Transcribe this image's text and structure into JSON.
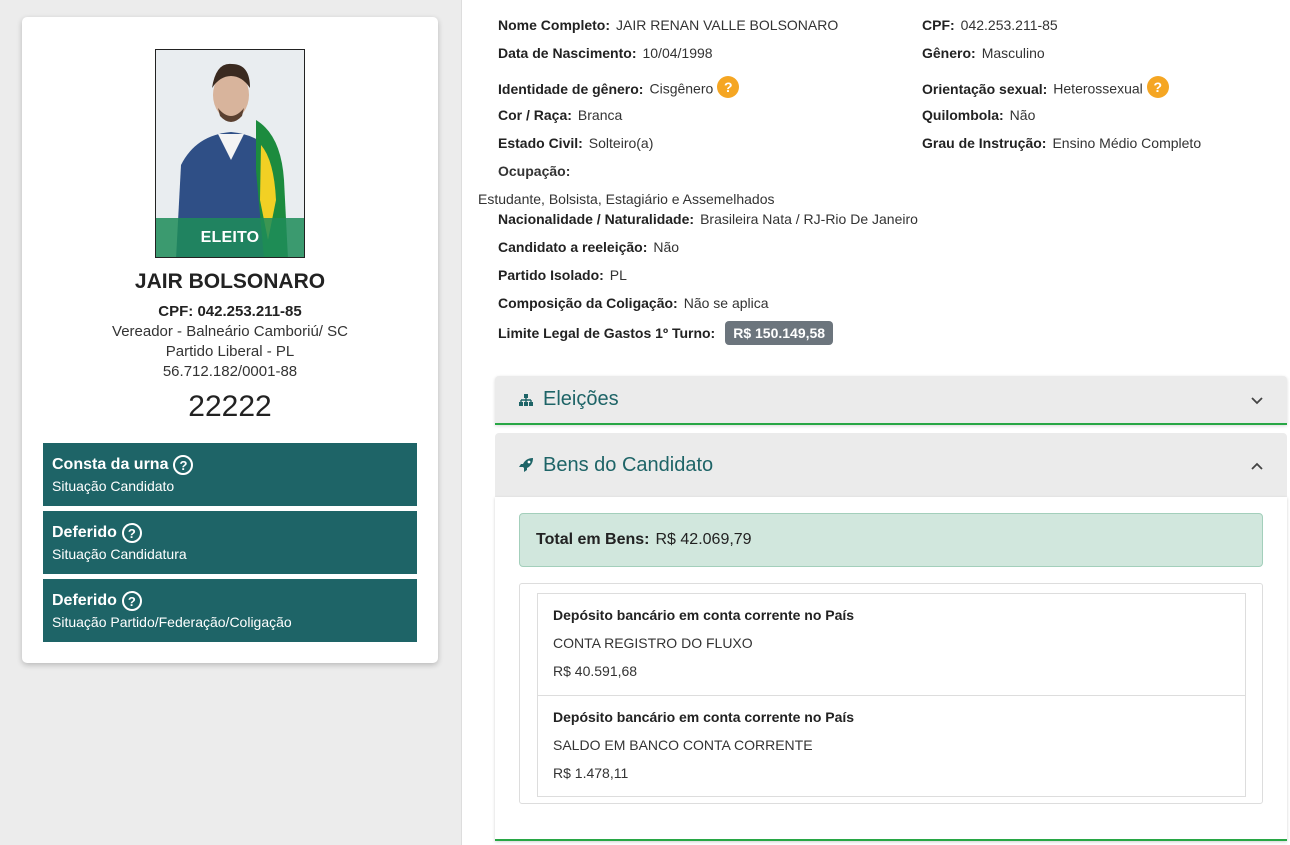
{
  "candidate": {
    "status_badge": "ELEITO",
    "name": "JAIR BOLSONARO",
    "cpf_line": "CPF: 042.253.211-85",
    "role": "Vereador - Balneário Camboriú/ SC",
    "party": "Partido Liberal - PL",
    "cnpj": "56.712.182/0001-88",
    "number": "22222"
  },
  "statuses": [
    {
      "title": "Consta da urna",
      "subtitle": "Situação Candidato"
    },
    {
      "title": "Deferido",
      "subtitle": "Situação Candidatura"
    },
    {
      "title": "Deferido",
      "subtitle": "Situação Partido/Federação/Coligação"
    }
  ],
  "help_glyph": "?",
  "details": {
    "nome_completo": {
      "label": "Nome Completo:",
      "value": "JAIR RENAN VALLE BOLSONARO"
    },
    "cpf": {
      "label": "CPF:",
      "value": "042.253.211-85"
    },
    "data_nascimento": {
      "label": "Data de Nascimento:",
      "value": "10/04/1998"
    },
    "genero": {
      "label": "Gênero:",
      "value": "Masculino"
    },
    "identidade_genero": {
      "label": "Identidade de gênero:",
      "value": "Cisgênero"
    },
    "orientacao_sexual": {
      "label": "Orientação sexual:",
      "value": "Heterossexual"
    },
    "cor_raca": {
      "label": "Cor / Raça:",
      "value": "Branca"
    },
    "quilombola": {
      "label": "Quilombola:",
      "value": "Não"
    },
    "estado_civil": {
      "label": "Estado Civil:",
      "value": "Solteiro(a)"
    },
    "grau_instrucao": {
      "label": "Grau de Instrução:",
      "value": "Ensino Médio Completo"
    },
    "ocupacao": {
      "label": "Ocupação:",
      "value": "Estudante, Bolsista, Estagiário e Assemelhados"
    },
    "nacionalidade": {
      "label": "Nacionalidade / Naturalidade:",
      "value": "Brasileira Nata / RJ-Rio De Janeiro"
    },
    "reeleicao": {
      "label": "Candidato a reeleição:",
      "value": "Não"
    },
    "partido_isolado": {
      "label": "Partido Isolado:",
      "value": "PL"
    },
    "coligacao": {
      "label": "Composição da Coligação:",
      "value": "Não se aplica"
    },
    "limite_gastos": {
      "label": "Limite Legal de Gastos 1º Turno:",
      "value": "R$ 150.149,58"
    }
  },
  "accordion": {
    "eleicoes_title": "Eleições",
    "bens_title": "Bens do Candidato",
    "total_label": "Total em Bens:",
    "total_value": "R$ 42.069,79",
    "items": [
      {
        "title": "Depósito bancário em conta corrente no País",
        "description": "CONTA REGISTRO DO FLUXO",
        "value": "R$ 40.591,68"
      },
      {
        "title": "Depósito bancário em conta corrente no País",
        "description": "SALDO EM BANCO CONTA CORRENTE",
        "value": "R$ 1.478,11"
      }
    ]
  },
  "colors": {
    "teal": "#1e6467",
    "green": "#28a745",
    "badge_orange": "#f5a623"
  },
  "icons": {
    "eleicoes": "sitemap-icon",
    "bens": "rocket-icon",
    "collapsed": "chevron-down-icon",
    "expanded": "chevron-up-icon"
  }
}
